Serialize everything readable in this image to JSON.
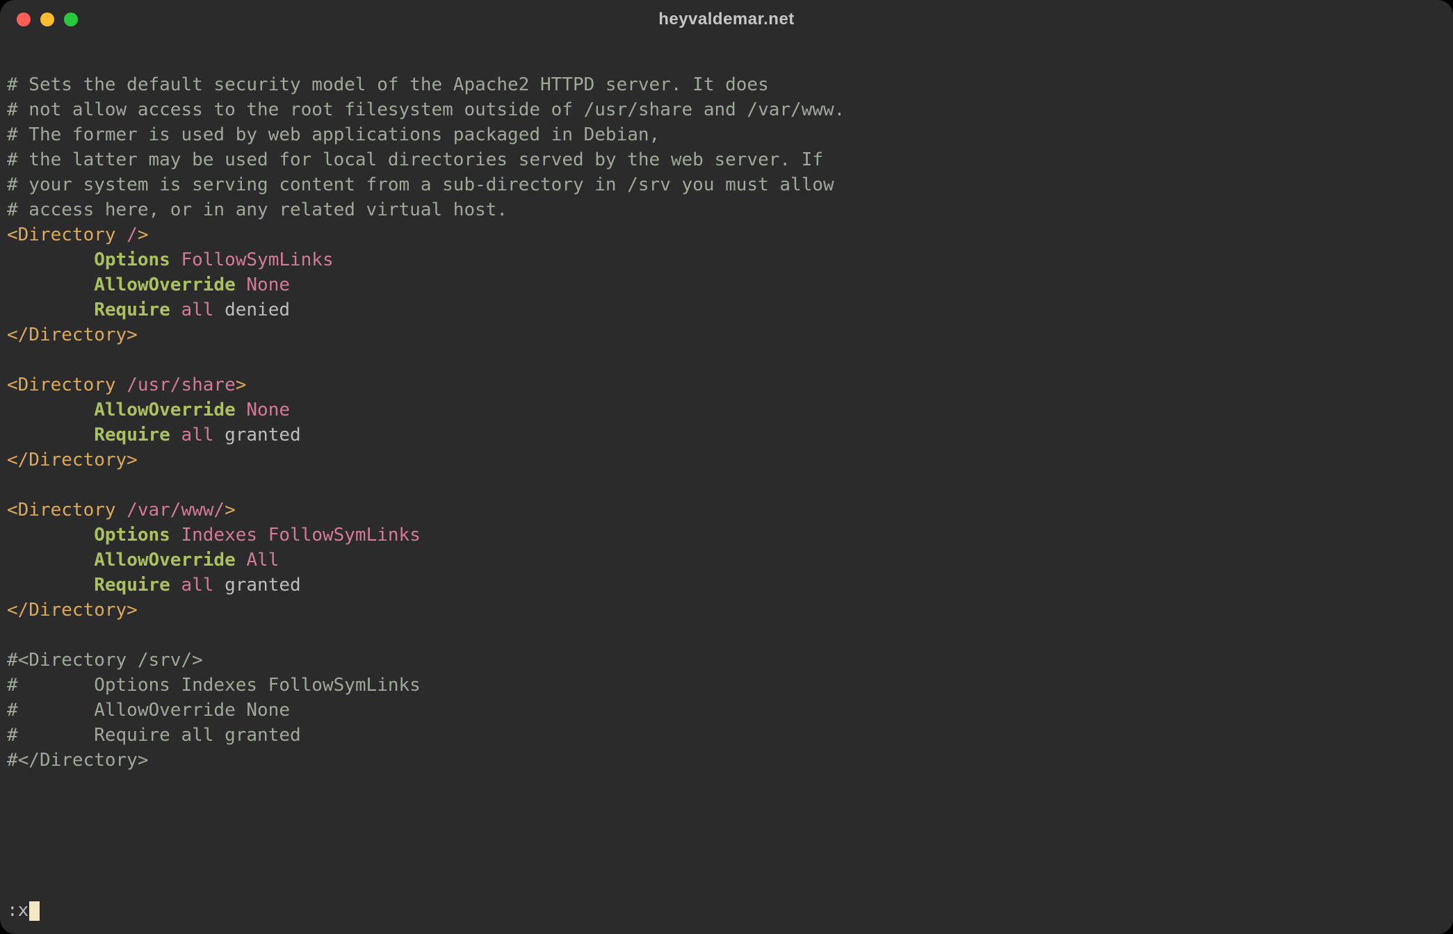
{
  "window": {
    "title": "heyvaldemar.net"
  },
  "status": {
    "command": ":x"
  },
  "lines": [
    {
      "segments": [
        {
          "cls": "c-comment",
          "text": "# Sets the default security model of the Apache2 HTTPD server. It does"
        }
      ]
    },
    {
      "segments": [
        {
          "cls": "c-comment",
          "text": "# not allow access to the root filesystem outside of /usr/share and /var/www."
        }
      ]
    },
    {
      "segments": [
        {
          "cls": "c-comment",
          "text": "# The former is used by web applications packaged in Debian,"
        }
      ]
    },
    {
      "segments": [
        {
          "cls": "c-comment",
          "text": "# the latter may be used for local directories served by the web server. If"
        }
      ]
    },
    {
      "segments": [
        {
          "cls": "c-comment",
          "text": "# your system is serving content from a sub-directory in /srv you must allow"
        }
      ]
    },
    {
      "segments": [
        {
          "cls": "c-comment",
          "text": "# access here, or in any related virtual host."
        }
      ]
    },
    {
      "segments": [
        {
          "cls": "c-tag",
          "text": "<Directory "
        },
        {
          "cls": "c-path",
          "text": "/"
        },
        {
          "cls": "c-tag",
          "text": ">"
        }
      ]
    },
    {
      "segments": [
        {
          "cls": "c-plain",
          "text": "        "
        },
        {
          "cls": "c-keyword",
          "text": "Options"
        },
        {
          "cls": "c-plain",
          "text": " "
        },
        {
          "cls": "c-value",
          "text": "FollowSymLinks"
        }
      ]
    },
    {
      "segments": [
        {
          "cls": "c-plain",
          "text": "        "
        },
        {
          "cls": "c-keyword",
          "text": "AllowOverride"
        },
        {
          "cls": "c-plain",
          "text": " "
        },
        {
          "cls": "c-value",
          "text": "None"
        }
      ]
    },
    {
      "segments": [
        {
          "cls": "c-plain",
          "text": "        "
        },
        {
          "cls": "c-keyword",
          "text": "Require"
        },
        {
          "cls": "c-plain",
          "text": " "
        },
        {
          "cls": "c-value",
          "text": "all"
        },
        {
          "cls": "c-plain",
          "text": " denied"
        }
      ]
    },
    {
      "segments": [
        {
          "cls": "c-tag",
          "text": "</Directory>"
        }
      ]
    },
    {
      "segments": [
        {
          "cls": "c-plain",
          "text": " "
        }
      ]
    },
    {
      "segments": [
        {
          "cls": "c-tag",
          "text": "<Directory "
        },
        {
          "cls": "c-path",
          "text": "/usr/share"
        },
        {
          "cls": "c-tag",
          "text": ">"
        }
      ]
    },
    {
      "segments": [
        {
          "cls": "c-plain",
          "text": "        "
        },
        {
          "cls": "c-keyword",
          "text": "AllowOverride"
        },
        {
          "cls": "c-plain",
          "text": " "
        },
        {
          "cls": "c-value",
          "text": "None"
        }
      ]
    },
    {
      "segments": [
        {
          "cls": "c-plain",
          "text": "        "
        },
        {
          "cls": "c-keyword",
          "text": "Require"
        },
        {
          "cls": "c-plain",
          "text": " "
        },
        {
          "cls": "c-value",
          "text": "all"
        },
        {
          "cls": "c-plain",
          "text": " granted"
        }
      ]
    },
    {
      "segments": [
        {
          "cls": "c-tag",
          "text": "</Directory>"
        }
      ]
    },
    {
      "segments": [
        {
          "cls": "c-plain",
          "text": " "
        }
      ]
    },
    {
      "segments": [
        {
          "cls": "c-tag",
          "text": "<Directory "
        },
        {
          "cls": "c-path",
          "text": "/var/www/"
        },
        {
          "cls": "c-tag",
          "text": ">"
        }
      ]
    },
    {
      "segments": [
        {
          "cls": "c-plain",
          "text": "        "
        },
        {
          "cls": "c-keyword",
          "text": "Options"
        },
        {
          "cls": "c-plain",
          "text": " "
        },
        {
          "cls": "c-value",
          "text": "Indexes"
        },
        {
          "cls": "c-plain",
          "text": " "
        },
        {
          "cls": "c-value",
          "text": "FollowSymLinks"
        }
      ]
    },
    {
      "segments": [
        {
          "cls": "c-plain",
          "text": "        "
        },
        {
          "cls": "c-keyword",
          "text": "AllowOverride"
        },
        {
          "cls": "c-plain",
          "text": " "
        },
        {
          "cls": "c-value",
          "text": "All"
        }
      ]
    },
    {
      "segments": [
        {
          "cls": "c-plain",
          "text": "        "
        },
        {
          "cls": "c-keyword",
          "text": "Require"
        },
        {
          "cls": "c-plain",
          "text": " "
        },
        {
          "cls": "c-value",
          "text": "all"
        },
        {
          "cls": "c-plain",
          "text": " granted"
        }
      ]
    },
    {
      "segments": [
        {
          "cls": "c-tag",
          "text": "</Directory>"
        }
      ]
    },
    {
      "segments": [
        {
          "cls": "c-plain",
          "text": " "
        }
      ]
    },
    {
      "segments": [
        {
          "cls": "c-comment",
          "text": "#<Directory /srv/>"
        }
      ]
    },
    {
      "segments": [
        {
          "cls": "c-comment",
          "text": "#       Options Indexes FollowSymLinks"
        }
      ]
    },
    {
      "segments": [
        {
          "cls": "c-comment",
          "text": "#       AllowOverride None"
        }
      ]
    },
    {
      "segments": [
        {
          "cls": "c-comment",
          "text": "#       Require all granted"
        }
      ]
    },
    {
      "segments": [
        {
          "cls": "c-comment",
          "text": "#</Directory>"
        }
      ]
    }
  ]
}
